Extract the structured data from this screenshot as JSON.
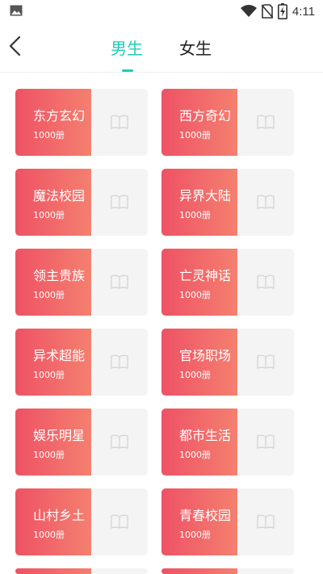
{
  "status_bar": {
    "time": "4:11"
  },
  "header": {
    "tabs": [
      {
        "label": "男生",
        "active": true
      },
      {
        "label": "女生",
        "active": false
      }
    ]
  },
  "categories": [
    {
      "name": "东方玄幻",
      "count": "1000册"
    },
    {
      "name": "西方奇幻",
      "count": "1000册"
    },
    {
      "name": "魔法校园",
      "count": "1000册"
    },
    {
      "name": "异界大陆",
      "count": "1000册"
    },
    {
      "name": "领主贵族",
      "count": "1000册"
    },
    {
      "name": "亡灵神话",
      "count": "1000册"
    },
    {
      "name": "异术超能",
      "count": "1000册"
    },
    {
      "name": "官场职场",
      "count": "1000册"
    },
    {
      "name": "娱乐明星",
      "count": "1000册"
    },
    {
      "name": "都市生活",
      "count": "1000册"
    },
    {
      "name": "山村乡土",
      "count": "1000册"
    },
    {
      "name": "青春校园",
      "count": "1000册"
    },
    {
      "name": "",
      "count": ""
    },
    {
      "name": "",
      "count": ""
    }
  ],
  "colors": {
    "accent": "#1ccdb4",
    "card_gradient_start": "#ee5265",
    "card_gradient_end": "#f4806f"
  }
}
